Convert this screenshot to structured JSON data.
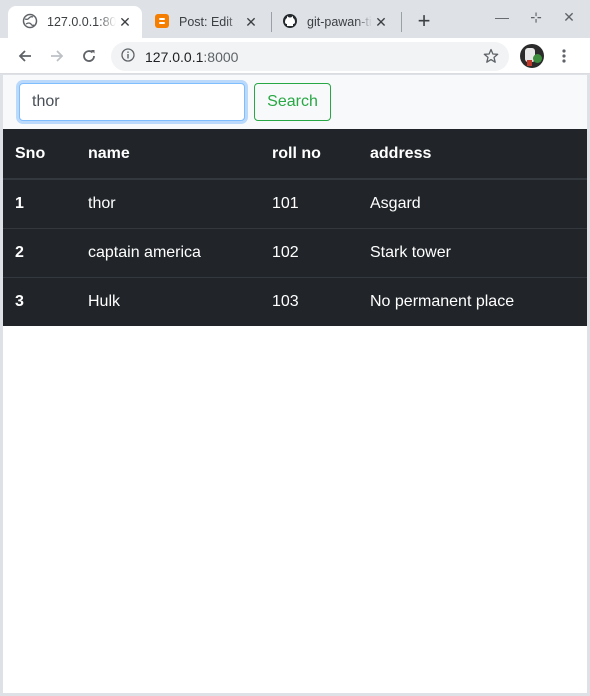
{
  "browser": {
    "tabs": [
      {
        "title": "127.0.0.1:8000",
        "icon": "globe-icon"
      },
      {
        "title": "Post: Edit",
        "icon": "blogger-icon"
      },
      {
        "title": "git-pawan-tiwari",
        "icon": "github-icon"
      }
    ],
    "url_host": "127.0.0.1",
    "url_port": ":8000"
  },
  "search": {
    "value": "thor",
    "button_label": "Search"
  },
  "table": {
    "headers": [
      "Sno",
      "name",
      "roll no",
      "address"
    ],
    "rows": [
      {
        "sno": "1",
        "name": "thor",
        "roll": "101",
        "address": "Asgard"
      },
      {
        "sno": "2",
        "name": "captain america",
        "roll": "102",
        "address": "Stark tower"
      },
      {
        "sno": "3",
        "name": "Hulk",
        "roll": "103",
        "address": "No permanent place"
      }
    ]
  },
  "colors": {
    "table_bg": "#212529",
    "search_button": "#28a745",
    "focus_ring": "#80bdff"
  }
}
